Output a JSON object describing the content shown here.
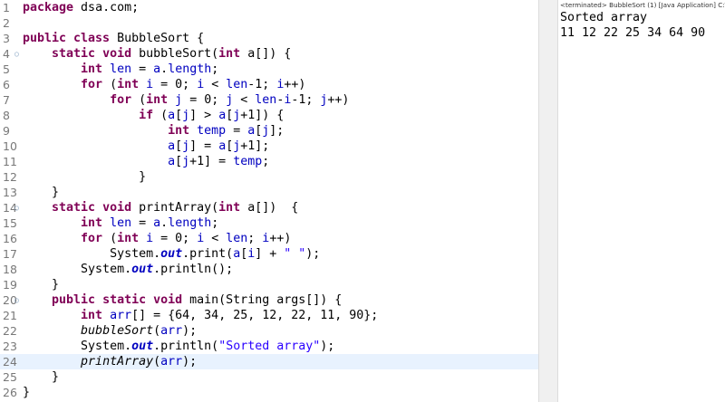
{
  "editor": {
    "lines": [
      {
        "n": "1",
        "t": [
          {
            "k": "kw",
            "v": "package"
          },
          {
            "v": " dsa.com;"
          }
        ]
      },
      {
        "n": "2",
        "t": []
      },
      {
        "n": "3",
        "t": [
          {
            "k": "kw",
            "v": "public class"
          },
          {
            "v": " BubbleSort {"
          }
        ]
      },
      {
        "n": "4",
        "fold": true,
        "t": [
          {
            "v": "    "
          },
          {
            "k": "kw",
            "v": "static void"
          },
          {
            "v": " bubbleSort("
          },
          {
            "k": "kw",
            "v": "int"
          },
          {
            "v": " a[]) {"
          }
        ]
      },
      {
        "n": "5",
        "t": [
          {
            "v": "        "
          },
          {
            "k": "kw",
            "v": "int"
          },
          {
            "v": " "
          },
          {
            "k": "fld",
            "v": "len"
          },
          {
            "v": " = "
          },
          {
            "k": "fld",
            "v": "a"
          },
          {
            "v": "."
          },
          {
            "k": "fld",
            "v": "length"
          },
          {
            "v": ";"
          }
        ]
      },
      {
        "n": "6",
        "t": [
          {
            "v": "        "
          },
          {
            "k": "kw",
            "v": "for"
          },
          {
            "v": " ("
          },
          {
            "k": "kw",
            "v": "int"
          },
          {
            "v": " "
          },
          {
            "k": "fld",
            "v": "i"
          },
          {
            "v": " = 0; "
          },
          {
            "k": "fld",
            "v": "i"
          },
          {
            "v": " < "
          },
          {
            "k": "fld",
            "v": "len"
          },
          {
            "v": "-1; "
          },
          {
            "k": "fld",
            "v": "i"
          },
          {
            "v": "++)"
          }
        ]
      },
      {
        "n": "7",
        "t": [
          {
            "v": "            "
          },
          {
            "k": "kw",
            "v": "for"
          },
          {
            "v": " ("
          },
          {
            "k": "kw",
            "v": "int"
          },
          {
            "v": " "
          },
          {
            "k": "fld",
            "v": "j"
          },
          {
            "v": " = 0; "
          },
          {
            "k": "fld",
            "v": "j"
          },
          {
            "v": " < "
          },
          {
            "k": "fld",
            "v": "len"
          },
          {
            "v": "-"
          },
          {
            "k": "fld",
            "v": "i"
          },
          {
            "v": "-1; "
          },
          {
            "k": "fld",
            "v": "j"
          },
          {
            "v": "++)"
          }
        ]
      },
      {
        "n": "8",
        "t": [
          {
            "v": "                "
          },
          {
            "k": "kw",
            "v": "if"
          },
          {
            "v": " ("
          },
          {
            "k": "fld",
            "v": "a"
          },
          {
            "v": "["
          },
          {
            "k": "fld",
            "v": "j"
          },
          {
            "v": "] > "
          },
          {
            "k": "fld",
            "v": "a"
          },
          {
            "v": "["
          },
          {
            "k": "fld",
            "v": "j"
          },
          {
            "v": "+1]) {"
          }
        ]
      },
      {
        "n": "9",
        "t": [
          {
            "v": "                    "
          },
          {
            "k": "kw",
            "v": "int"
          },
          {
            "v": " "
          },
          {
            "k": "fld",
            "v": "temp"
          },
          {
            "v": " = "
          },
          {
            "k": "fld",
            "v": "a"
          },
          {
            "v": "["
          },
          {
            "k": "fld",
            "v": "j"
          },
          {
            "v": "];"
          }
        ]
      },
      {
        "n": "10",
        "t": [
          {
            "v": "                    "
          },
          {
            "k": "fld",
            "v": "a"
          },
          {
            "v": "["
          },
          {
            "k": "fld",
            "v": "j"
          },
          {
            "v": "] = "
          },
          {
            "k": "fld",
            "v": "a"
          },
          {
            "v": "["
          },
          {
            "k": "fld",
            "v": "j"
          },
          {
            "v": "+1];"
          }
        ]
      },
      {
        "n": "11",
        "t": [
          {
            "v": "                    "
          },
          {
            "k": "fld",
            "v": "a"
          },
          {
            "v": "["
          },
          {
            "k": "fld",
            "v": "j"
          },
          {
            "v": "+1] = "
          },
          {
            "k": "fld",
            "v": "temp"
          },
          {
            "v": ";"
          }
        ]
      },
      {
        "n": "12",
        "t": [
          {
            "v": "                }"
          }
        ]
      },
      {
        "n": "13",
        "t": [
          {
            "v": "    }"
          }
        ]
      },
      {
        "n": "14",
        "fold": true,
        "t": [
          {
            "v": "    "
          },
          {
            "k": "kw",
            "v": "static void"
          },
          {
            "v": " printArray("
          },
          {
            "k": "kw",
            "v": "int"
          },
          {
            "v": " a[])  {"
          }
        ]
      },
      {
        "n": "15",
        "t": [
          {
            "v": "        "
          },
          {
            "k": "kw",
            "v": "int"
          },
          {
            "v": " "
          },
          {
            "k": "fld",
            "v": "len"
          },
          {
            "v": " = "
          },
          {
            "k": "fld",
            "v": "a"
          },
          {
            "v": "."
          },
          {
            "k": "fld",
            "v": "length"
          },
          {
            "v": ";"
          }
        ]
      },
      {
        "n": "16",
        "t": [
          {
            "v": "        "
          },
          {
            "k": "kw",
            "v": "for"
          },
          {
            "v": " ("
          },
          {
            "k": "kw",
            "v": "int"
          },
          {
            "v": " "
          },
          {
            "k": "fld",
            "v": "i"
          },
          {
            "v": " = 0; "
          },
          {
            "k": "fld",
            "v": "i"
          },
          {
            "v": " < "
          },
          {
            "k": "fld",
            "v": "len"
          },
          {
            "v": "; "
          },
          {
            "k": "fld",
            "v": "i"
          },
          {
            "v": "++)"
          }
        ]
      },
      {
        "n": "17",
        "t": [
          {
            "v": "            System."
          },
          {
            "k": "sfield",
            "v": "out"
          },
          {
            "v": ".print("
          },
          {
            "k": "fld",
            "v": "a"
          },
          {
            "v": "["
          },
          {
            "k": "fld",
            "v": "i"
          },
          {
            "v": "] + "
          },
          {
            "k": "str",
            "v": "\" \""
          },
          {
            "v": ");"
          }
        ]
      },
      {
        "n": "18",
        "t": [
          {
            "v": "        System."
          },
          {
            "k": "sfield",
            "v": "out"
          },
          {
            "v": ".println();"
          }
        ]
      },
      {
        "n": "19",
        "t": [
          {
            "v": "    }"
          }
        ]
      },
      {
        "n": "20",
        "fold": true,
        "t": [
          {
            "v": "    "
          },
          {
            "k": "kw",
            "v": "public static void"
          },
          {
            "v": " main(String args[]) {"
          }
        ]
      },
      {
        "n": "21",
        "t": [
          {
            "v": "        "
          },
          {
            "k": "kw",
            "v": "int"
          },
          {
            "v": " "
          },
          {
            "k": "fld",
            "v": "arr"
          },
          {
            "v": "[] = {64, 34, 25, 12, 22, 11, 90};"
          }
        ]
      },
      {
        "n": "22",
        "t": [
          {
            "v": "        "
          },
          {
            "k": "smeth",
            "v": "bubbleSort"
          },
          {
            "v": "("
          },
          {
            "k": "fld",
            "v": "arr"
          },
          {
            "v": ");"
          }
        ]
      },
      {
        "n": "23",
        "t": [
          {
            "v": "        System."
          },
          {
            "k": "sfield",
            "v": "out"
          },
          {
            "v": ".println("
          },
          {
            "k": "str",
            "v": "\"Sorted array\""
          },
          {
            "v": ");"
          }
        ]
      },
      {
        "n": "24",
        "current": true,
        "t": [
          {
            "v": "        "
          },
          {
            "k": "smeth",
            "v": "printArray"
          },
          {
            "v": "("
          },
          {
            "k": "fld",
            "v": "arr"
          },
          {
            "v": ");"
          }
        ]
      },
      {
        "n": "25",
        "t": [
          {
            "v": "    }"
          }
        ]
      },
      {
        "n": "26",
        "t": [
          {
            "v": "}"
          }
        ]
      }
    ]
  },
  "console": {
    "header": "<terminated> BubbleSort (1) [Java Application] C:\\",
    "output": [
      "Sorted array",
      "11 12 22 25 34 64 90"
    ]
  }
}
